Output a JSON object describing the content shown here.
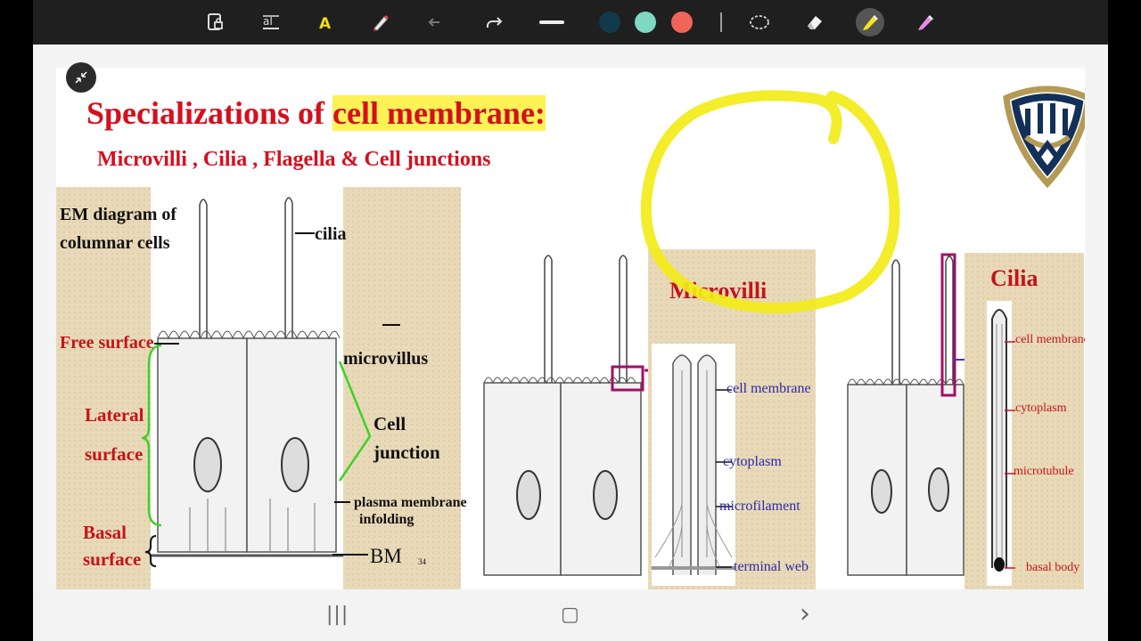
{
  "toolbar": {
    "tools": [
      "page-lock-icon",
      "text-icon",
      "highlight-text-icon",
      "pen-icon",
      "undo-icon",
      "redo-icon",
      "line-width-icon",
      "lasso-icon",
      "eraser-icon",
      "highlighter-icon",
      "marker-icon"
    ],
    "colors": [
      "#123a4a",
      "#7fd8c0",
      "#f0645a"
    ],
    "active_tool": "highlighter-icon"
  },
  "slide": {
    "title_prefix": "Specializations of ",
    "title_highlight": "cell membrane:",
    "subtitle": "Microvilli , Cilia , Flagella & Cell junctions",
    "left_panel": {
      "heading_line1": "EM diagram of",
      "heading_line2": "columnar cells",
      "cilia": "cilia",
      "free_surface": "Free surface",
      "lateral": "Lateral",
      "surface": "surface",
      "basal": "Basal",
      "basal_surface": "surface",
      "microvillus": "microvillus",
      "cell": "Cell",
      "junction": "junction",
      "plasma_line1": "plasma membrane",
      "plasma_line2": "infolding",
      "bm": "BM",
      "page_no": "34"
    },
    "microvilli_panel": {
      "title": "Microvilli",
      "cell_membrane": "cell membrane",
      "cytoplasm": "cytoplasm",
      "microfilament": "microfilament",
      "terminal_web": "terminal web"
    },
    "cilia_panel": {
      "title": "Cilia",
      "cell_membrane": "cell membrane",
      "cytoplasm": "cytoplasm",
      "microtubule": "microtubule",
      "basal_body": "basal body"
    }
  },
  "nav": {
    "recents": "|||",
    "home": "▢",
    "back": "›"
  },
  "colors": {
    "title_red": "#d50f1e",
    "highlight_yellow": "#ffee1e",
    "annotation_yellow": "#f2ec18",
    "green_bracket": "#3ed12a",
    "magenta_box": "#a01066",
    "logo_navy": "#12305a",
    "logo_gold": "#b59a55"
  }
}
